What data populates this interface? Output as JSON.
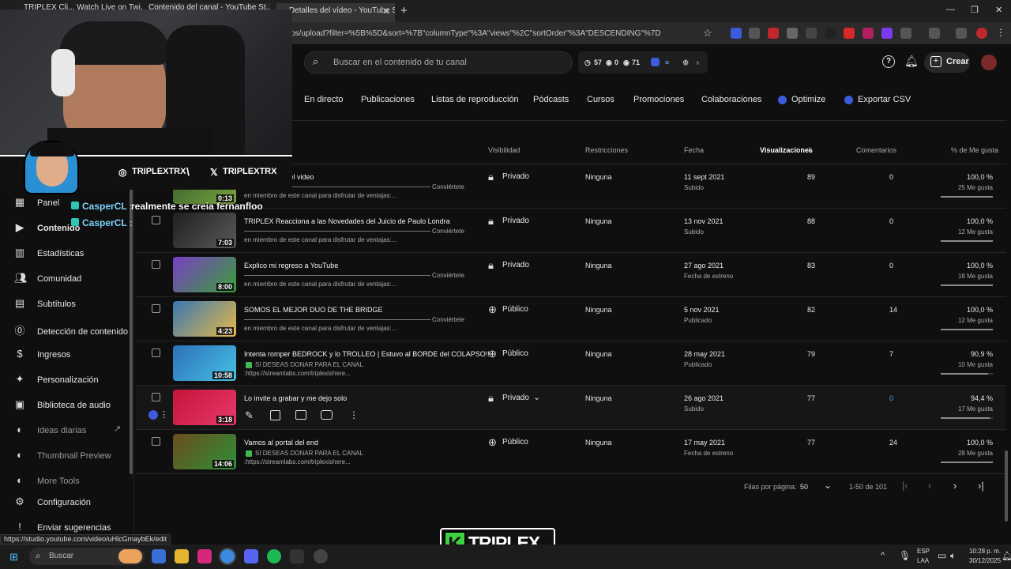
{
  "browser": {
    "tabs": [
      "TRIPLEX Cli... Watch Live on Twi...",
      "Contenido del canal - YouTube St...",
      "Detalles del vídeo - YouTube St..."
    ],
    "url": "os/upload?filter=%5B%5D&sort=%7B\"columnType\"%3A\"views\"%2C\"sortOrder\"%3A\"DESCENDING\"%7D",
    "status_url": "https://studio.youtube.com/video/uHlcGmaybEk/edit"
  },
  "header": {
    "search_placeholder": "Buscar en el contenido de tu canal",
    "stats": [
      "57",
      "0",
      "71"
    ],
    "create_label": "Crear"
  },
  "tabs": [
    "En directo",
    "Publicaciones",
    "Listas de reproducción",
    "Pódcasts",
    "Cursos",
    "Promociones",
    "Colaboraciones",
    "Optimize",
    "Exportar CSV"
  ],
  "columns": {
    "visibility": "Visibilidad",
    "restrictions": "Restricciones",
    "date": "Fecha",
    "views": "Visualizaciones",
    "comments": "Comentarios",
    "likes": "% de Me gusta"
  },
  "rows": [
    {
      "title": "...ona termina el video",
      "desc": "en miembro de este canal para disfrutar de ventajas:...",
      "desc_extra": "Conviértete",
      "duration": "0:13",
      "visibility": "Privado",
      "restriction": "Ninguna",
      "date": "11 sept 2021",
      "date_status": "Subido",
      "views": "89",
      "comments": "0",
      "likes_pct": "100,0 %",
      "likes_count": "25 Me gusta",
      "like_ratio": 1.0
    },
    {
      "title": "TRIPLEX Reacciona a las Novedades del Juicio de Paulo Londra",
      "desc": "en miembro de este canal para disfrutar de ventajas:...",
      "desc_extra": "Conviértete",
      "duration": "7:03",
      "visibility": "Privado",
      "restriction": "Ninguna",
      "date": "13 nov 2021",
      "date_status": "Subido",
      "views": "88",
      "comments": "0",
      "likes_pct": "100,0 %",
      "likes_count": "12 Me gusta",
      "like_ratio": 1.0
    },
    {
      "title": "Explico mi regreso a YouTube",
      "desc": "en miembro de este canal para disfrutar de ventajas:...",
      "desc_extra": "Conviértete",
      "duration": "8:00",
      "visibility": "Privado",
      "restriction": "Ninguna",
      "date": "27 ago 2021",
      "date_status": "Fecha de estreno",
      "views": "83",
      "comments": "0",
      "likes_pct": "100,0 %",
      "likes_count": "18 Me gusta",
      "like_ratio": 1.0
    },
    {
      "title": "SOMOS EL MEJOR DUO DE THE BRIDGE",
      "desc": "en miembro de este canal para disfrutar de ventajas:...",
      "desc_extra": "Conviértete",
      "duration": "4:23",
      "visibility": "Público",
      "restriction": "Ninguna",
      "date": "5 nov 2021",
      "date_status": "Publicado",
      "views": "82",
      "comments": "14",
      "likes_pct": "100,0 %",
      "likes_count": "12 Me gusta",
      "like_ratio": 1.0
    },
    {
      "title": "Intenta romper BEDROCK y lo TROLLEO | Estuvo al BORDE del COLAPSO!!",
      "desc": "SI DESEAS DONAR PARA EL CANAL",
      "desc2": ":https://streamlabs.com/triplexishere...",
      "duration": "10:58",
      "visibility": "Público",
      "restriction": "Ninguna",
      "date": "28 may 2021",
      "date_status": "Publicado",
      "views": "79",
      "comments": "7",
      "likes_pct": "90,9 %",
      "likes_count": "10 Me gusta",
      "like_ratio": 0.909
    },
    {
      "title": "Lo invite a grabar y me dejo solo",
      "duration": "3:18",
      "visibility": "Privado",
      "restriction": "Ninguna",
      "date": "26 ago 2021",
      "date_status": "Subido",
      "views": "77",
      "comments": "0",
      "likes_pct": "94,4 %",
      "likes_count": "17 Me gusta",
      "like_ratio": 0.944
    },
    {
      "title": "Vamos al portal del end",
      "desc": "SI DESEAS DONAR PARA EL CANAL",
      "desc2": ":https://streamlabs.com/triplexishere...",
      "duration": "14:06",
      "visibility": "Público",
      "restriction": "Ninguna",
      "date": "17 may 2021",
      "date_status": "Fecha de estreno",
      "views": "77",
      "comments": "24",
      "likes_pct": "100,0 %",
      "likes_count": "28 Me gusta",
      "like_ratio": 1.0
    }
  ],
  "pagination": {
    "rows_label": "Filas por página:",
    "rows_value": "50",
    "range": "1-50 de 101"
  },
  "sidebar": [
    "Panel",
    "Contenido",
    "Estadísticas",
    "Comunidad",
    "Subtítulos",
    "Detección de contenido",
    "Ingresos",
    "Personalización",
    "Biblioteca de audio",
    "Ideas diarias",
    "Thumbnail Preview",
    "More Tools",
    "Configuración",
    "Enviar sugerencias"
  ],
  "overlay": {
    "instagram": "TRIPLEXTRX",
    "x_handle": "TRIPLEXTRX",
    "chat1_user": "CasperCL :",
    "chat1_msg": "realmente se creia fernanfloo",
    "chat2_user": "CasperCL :",
    "logo": "TRIPLEX"
  },
  "taskbar": {
    "search": "Buscar",
    "lang1": "ESP",
    "lang2": "LAA",
    "time": "10:28 p. m.",
    "date": "30/12/2025"
  }
}
